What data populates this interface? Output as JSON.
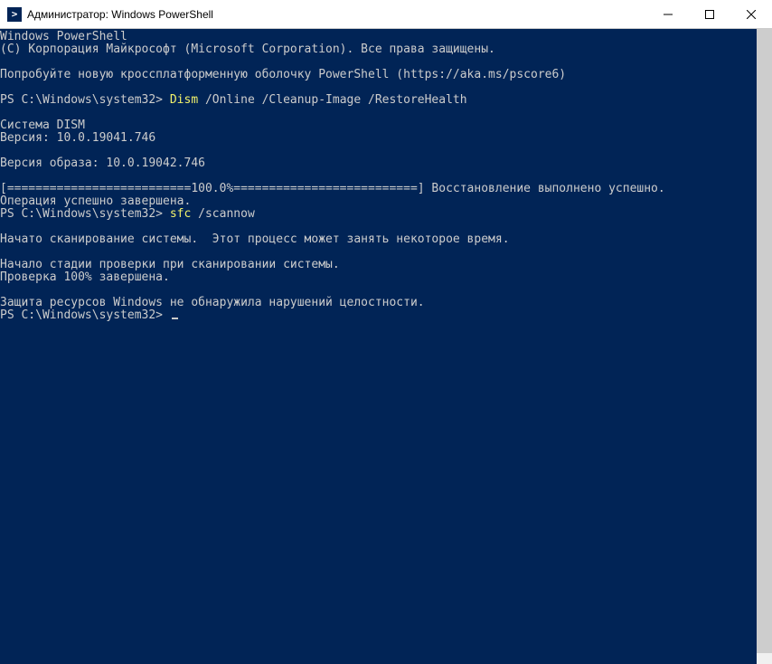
{
  "titlebar": {
    "text": "Администратор: Windows PowerShell"
  },
  "terminal": {
    "line01": "Windows PowerShell",
    "line02": "(C) Корпорация Майкрософт (Microsoft Corporation). Все права защищены.",
    "line03": "",
    "line04": "Попробуйте новую кроссплатформенную оболочку PowerShell (https://aka.ms/pscore6)",
    "line05": "",
    "prompt1_ps": "PS C:\\Windows\\system32> ",
    "prompt1_cmd": "Dism",
    "prompt1_rest": " /Online /Cleanup-Image /RestoreHealth",
    "line07": "",
    "line08": "Система DISM",
    "line09": "Версия: 10.0.19041.746",
    "line10": "",
    "line11": "Версия образа: 10.0.19042.746",
    "line12": "",
    "line13": "[==========================100.0%==========================] Восстановление выполнено успешно.",
    "line14": "Операция успешно завершена.",
    "prompt2_ps": "PS C:\\Windows\\system32> ",
    "prompt2_cmd": "sfc",
    "prompt2_rest": " /scannow",
    "line16": "",
    "line17": "Начато сканирование системы.  Этот процесс может занять некоторое время.",
    "line18": "",
    "line19": "Начало стадии проверки при сканировании системы.",
    "line20": "Проверка 100% завершена.",
    "line21": "",
    "line22": "Защита ресурсов Windows не обнаружила нарушений целостности.",
    "prompt3_ps": "PS C:\\Windows\\system32> "
  }
}
